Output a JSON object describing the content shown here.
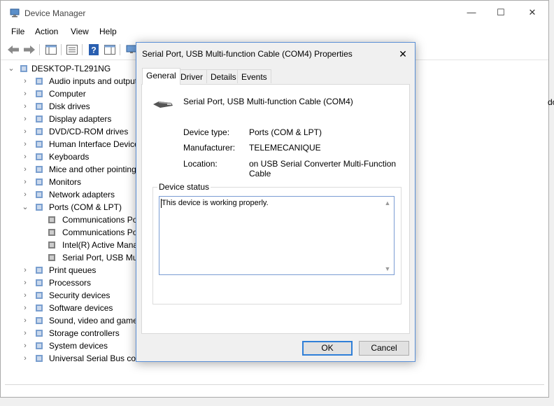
{
  "window": {
    "title": "Device Manager",
    "minimize_glyph": "—",
    "maximize_glyph": "☐",
    "close_glyph": "✕"
  },
  "menu": [
    "File",
    "Action",
    "View",
    "Help"
  ],
  "toolbar": {
    "icons": [
      "back-arrow-icon",
      "forward-arrow-icon",
      "show-hide-console-tree-icon",
      "properties-icon",
      "help-icon",
      "action-pane-icon",
      "monitor-icon"
    ]
  },
  "tree": {
    "root": "DESKTOP-TL291NG",
    "categories": [
      {
        "label": "Audio inputs and outputs",
        "icon": "speaker-icon",
        "expanded": false
      },
      {
        "label": "Computer",
        "icon": "computer-icon",
        "expanded": false
      },
      {
        "label": "Disk drives",
        "icon": "disk-drive-icon",
        "expanded": false
      },
      {
        "label": "Display adapters",
        "icon": "display-adapter-icon",
        "expanded": false
      },
      {
        "label": "DVD/CD-ROM drives",
        "icon": "dvd-drive-icon",
        "expanded": false
      },
      {
        "label": "Human Interface Devices",
        "icon": "hid-icon",
        "expanded": false
      },
      {
        "label": "Keyboards",
        "icon": "keyboard-icon",
        "expanded": false
      },
      {
        "label": "Mice and other pointing devices",
        "icon": "mouse-icon",
        "expanded": false
      },
      {
        "label": "Monitors",
        "icon": "monitor-icon",
        "expanded": false
      },
      {
        "label": "Network adapters",
        "icon": "network-adapter-icon",
        "expanded": false
      },
      {
        "label": "Ports (COM & LPT)",
        "icon": "port-icon",
        "expanded": true,
        "children": [
          "Communications Port (COM1)",
          "Communications Port (COM2)",
          "Intel(R) Active Management",
          "Serial Port, USB Multi-function Cable (COM4)"
        ]
      },
      {
        "label": "Print queues",
        "icon": "printer-icon",
        "expanded": false
      },
      {
        "label": "Processors",
        "icon": "processor-icon",
        "expanded": false
      },
      {
        "label": "Security devices",
        "icon": "security-device-icon",
        "expanded": false
      },
      {
        "label": "Software devices",
        "icon": "software-device-icon",
        "expanded": false
      },
      {
        "label": "Sound, video and game controllers",
        "icon": "sound-icon",
        "expanded": false
      },
      {
        "label": "Storage controllers",
        "icon": "storage-controller-icon",
        "expanded": false
      },
      {
        "label": "System devices",
        "icon": "system-device-icon",
        "expanded": false
      },
      {
        "label": "Universal Serial Bus controllers",
        "icon": "usb-icon",
        "expanded": false
      }
    ]
  },
  "edge_glimpse": "do",
  "dialog": {
    "title": "Serial Port, USB Multi-function Cable (COM4) Properties",
    "close_glyph": "✕",
    "tabs": [
      "General",
      "Driver",
      "Details",
      "Events"
    ],
    "active_tab": "General",
    "device_name": "Serial Port, USB Multi-function Cable (COM4)",
    "properties": [
      {
        "label": "Device type:",
        "value": "Ports (COM & LPT)"
      },
      {
        "label": "Manufacturer:",
        "value": "TELEMECANIQUE"
      },
      {
        "label": "Location:",
        "value": "on USB Serial Converter Multi-Function Cable"
      }
    ],
    "status_group_label": "Device status",
    "status_text": "This device is working properly.",
    "ok_label": "OK",
    "cancel_label": "Cancel"
  },
  "colors": {
    "accent_blue": "#2f7fd8",
    "dialog_border": "#5a8fd6"
  }
}
